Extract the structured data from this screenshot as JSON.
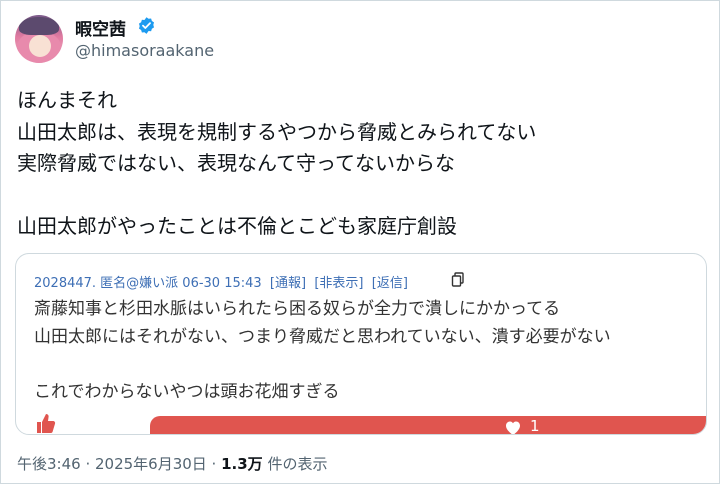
{
  "author": {
    "display_name": "暇空茜",
    "handle": "@himasoraakane",
    "verified": true
  },
  "tweet": {
    "lines": [
      "ほんまそれ",
      "山田太郎は、表現を規制するやつから脅威とみられてない",
      "実際脅威ではない、表現なんて守ってないからな",
      "",
      "山田太郎がやったことは不倫とこども家庭庁創設"
    ]
  },
  "quote": {
    "meta": "2028447. 匿名@嫌い派 06-30 15:43  [通報]  [非表示]  [返信]",
    "lines": [
      "斎藤知事と杉田水脈はいられたら困る奴らが全力で潰しにかかってる",
      "山田太郎にはそれがない、つまり脅威だと思われていない、潰す必要がない",
      "",
      "これでわからないやつは頭お花畑すぎる"
    ],
    "like_count": "1"
  },
  "footer": {
    "time_date": "午後3:46 · 2025年6月30日 · ",
    "views": "1.3万",
    "views_label": " 件の表示"
  },
  "colors": {
    "verified": "#1d9bf0",
    "link": "#3e6fb5",
    "like_bar": "#e0554f",
    "muted": "#536471"
  },
  "icons": [
    "verified-badge-icon",
    "more-icon",
    "copy-icon",
    "thumbs-up-icon",
    "heart-icon"
  ]
}
